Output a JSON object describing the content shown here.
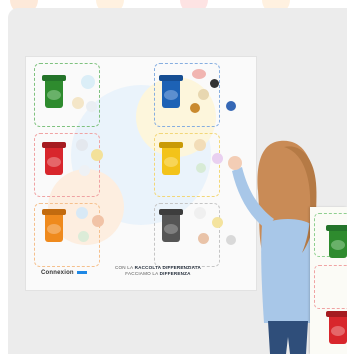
{
  "poster": {
    "brand": "Connexion",
    "tagline_prefix": "CON LA",
    "tagline_emphasis": "RACCOLTA DIFFERENZIATA",
    "tagline_line2_prefix": "FACCIAMO LA",
    "tagline_line2_emphasis": "DIFFERENZA"
  },
  "colors": {
    "green": "#2e8b2e",
    "blue": "#1d62b5",
    "red": "#d8262c",
    "yellow": "#f3c31a",
    "orange": "#ef8a1d",
    "gray": "#555555"
  },
  "bins": [
    {
      "name": "green-bin",
      "color": "green"
    },
    {
      "name": "blue-bin",
      "color": "blue"
    },
    {
      "name": "red-bin",
      "color": "red"
    },
    {
      "name": "yellow-bin",
      "color": "yellow"
    },
    {
      "name": "orange-bin",
      "color": "orange"
    },
    {
      "name": "gray-bin",
      "color": "gray"
    }
  ]
}
